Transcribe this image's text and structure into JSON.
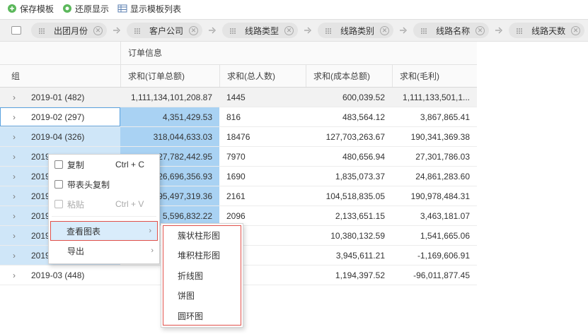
{
  "toolbar": {
    "save": "保存模板",
    "restore": "还原显示",
    "show_list": "显示模板列表"
  },
  "groupbar": {
    "chips": [
      "出团月份",
      "客户公司",
      "线路类型",
      "线路类别",
      "线路名称",
      "线路天数"
    ]
  },
  "table": {
    "group_header": "订单信息",
    "columns": [
      "组",
      "求和(订单总额)",
      "求和(总人数)",
      "求和(成本总额)",
      "求和(毛利)"
    ],
    "rows": [
      {
        "group": "2019-01 (482)",
        "order_total": "1,111,134,101,208.87",
        "people": "1445",
        "cost": "600,039.52",
        "profit": "1,111,133,501,1..."
      },
      {
        "group": "2019-02 (297)",
        "order_total": "4,351,429.53",
        "people": "816",
        "cost": "483,564.12",
        "profit": "3,867,865.41"
      },
      {
        "group": "2019-04 (326)",
        "order_total": "318,044,633.03",
        "people": "18476",
        "cost": "127,703,263.67",
        "profit": "190,341,369.38"
      },
      {
        "group": "2019",
        "order_total": "27,782,442.95",
        "people": "7970",
        "cost": "480,656.94",
        "profit": "27,301,786.03"
      },
      {
        "group": "2019",
        "order_total": "26,696,356.93",
        "people": "1690",
        "cost": "1,835,073.37",
        "profit": "24,861,283.60"
      },
      {
        "group": "2019",
        "order_total": "95,497,319.36",
        "people": "2161",
        "cost": "104,518,835.05",
        "profit": "190,978,484.31"
      },
      {
        "group": "2019",
        "order_total": "5,596,832.22",
        "people": "2096",
        "cost": "2,133,651.15",
        "profit": "3,463,181.07"
      },
      {
        "group": "2019",
        "order_total": "",
        "people": "",
        "cost": "10,380,132.59",
        "profit": "1,541,665.06"
      },
      {
        "group": "2019",
        "order_total": "",
        "people": "",
        "cost": "3,945,611.21",
        "profit": "-1,169,606.91"
      },
      {
        "group": "2019-03 (448)",
        "order_total": "-",
        "people": "3",
        "cost": "1,194,397.52",
        "profit": "-96,011,877.45"
      }
    ]
  },
  "context_menu": {
    "copy": "复制",
    "copy_shortcut": "Ctrl + C",
    "copy_with_header": "带表头复制",
    "paste": "粘贴",
    "paste_shortcut": "Ctrl + V",
    "view_chart": "查看图表",
    "export": "导出"
  },
  "chart_submenu": {
    "items": [
      "簇状柱形图",
      "堆积柱形图",
      "折线图",
      "饼图",
      "圆环图"
    ]
  },
  "colors": {
    "selection": "#a9d2f3",
    "selection_light": "#cfe6f8",
    "highlight_border": "#e0504a"
  }
}
